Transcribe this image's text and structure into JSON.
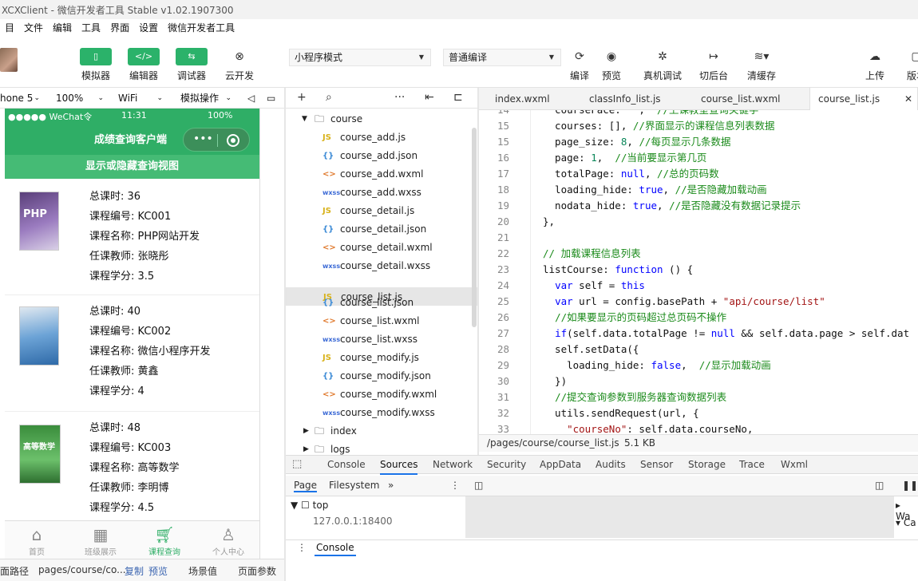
{
  "titlebar": {
    "title": "XCXClient - 微信开发者工具 Stable v1.02.1907300"
  },
  "menu": [
    "目",
    "文件",
    "编辑",
    "工具",
    "界面",
    "设置",
    "微信开发者工具"
  ],
  "toolbar": {
    "simulator": "模拟器",
    "editor": "编辑器",
    "debugger": "调试器",
    "cloud": "云开发",
    "mode_select": "小程序模式",
    "compile_select": "普通编译",
    "compile": "编译",
    "preview": "预览",
    "remote_debug": "真机调试",
    "background": "切后台",
    "clear_cache": "清缓存",
    "upload": "上传",
    "version": "版本"
  },
  "simstrip": {
    "device": "hone 5",
    "zoom": "100%",
    "network": "WiFi",
    "operate": "模拟操作"
  },
  "phone": {
    "status_left": "●●●●● WeChat令",
    "status_time": "11:31",
    "status_right": "100%",
    "nav_title": "成绩查询客户端",
    "toggle": "显示或隐藏查询视图",
    "courses": [
      {
        "hours": "总课时: 36",
        "no": "课程编号: KC001",
        "name": "课程名称: PHP网站开发",
        "teacher": "任课教师: 张晓彤",
        "credit": "课程学分: 3.5",
        "cover": "PHP"
      },
      {
        "hours": "总课时: 40",
        "no": "课程编号: KC002",
        "name": "课程名称: 微信小程序开发",
        "teacher": "任课教师: 黄鑫",
        "credit": "课程学分: 4",
        "cover": ""
      },
      {
        "hours": "总课时: 48",
        "no": "课程编号: KC003",
        "name": "课程名称: 高等数学",
        "teacher": "任课教师: 李明博",
        "credit": "课程学分: 4.5",
        "cover": "高等数学"
      }
    ],
    "tabs": [
      "首页",
      "班级展示",
      "课程查询",
      "个人中心"
    ]
  },
  "leftstatus": {
    "path_label": "面路径",
    "path": "pages/course/co...",
    "copy": "复制",
    "preview": "预览",
    "scene": "场景值",
    "params": "页面参数"
  },
  "tree": {
    "folder": "course",
    "files": [
      {
        "icon": "JS",
        "name": "course_add.js",
        "color": "#d8b21a"
      },
      {
        "icon": "{}",
        "name": "course_add.json",
        "color": "#3d8bd6"
      },
      {
        "icon": "<>",
        "name": "course_add.wxml",
        "color": "#e07a2e"
      },
      {
        "icon": "wxss",
        "name": "course_add.wxss",
        "color": "#3d6bd6"
      },
      {
        "icon": "JS",
        "name": "course_detail.js",
        "color": "#d8b21a"
      },
      {
        "icon": "{}",
        "name": "course_detail.json",
        "color": "#3d8bd6"
      },
      {
        "icon": "<>",
        "name": "course_detail.wxml",
        "color": "#e07a2e"
      },
      {
        "icon": "wxss",
        "name": "course_detail.wxss",
        "color": "#3d6bd6"
      },
      {
        "icon": "JS",
        "name": "course_list.js",
        "color": "#d8b21a"
      },
      {
        "icon": "{}",
        "name": "course_list.json",
        "color": "#3d8bd6"
      },
      {
        "icon": "<>",
        "name": "course_list.wxml",
        "color": "#e07a2e"
      },
      {
        "icon": "wxss",
        "name": "course_list.wxss",
        "color": "#3d6bd6"
      },
      {
        "icon": "JS",
        "name": "course_modify.js",
        "color": "#d8b21a"
      },
      {
        "icon": "{}",
        "name": "course_modify.json",
        "color": "#3d8bd6"
      },
      {
        "icon": "<>",
        "name": "course_modify.wxml",
        "color": "#e07a2e"
      },
      {
        "icon": "wxss",
        "name": "course_modify.wxss",
        "color": "#3d6bd6"
      }
    ],
    "folders_after": [
      "index",
      "logs"
    ]
  },
  "editor": {
    "tabs": [
      "index.wxml",
      "classInfo_list.js",
      "course_list.wxml",
      "course_list.js"
    ],
    "status_path": "/pages/course/course_list.js",
    "status_size": "5.1 KB"
  },
  "devtools": {
    "tabs": [
      "Console",
      "Sources",
      "Network",
      "Security",
      "AppData",
      "Audits",
      "Sensor",
      "Storage",
      "Trace",
      "Wxml"
    ],
    "subtabs": [
      "Page",
      "Filesystem"
    ],
    "tree_top": "top",
    "tree_host": "127.0.0.1:18400",
    "side": [
      "Wa",
      "Ca"
    ],
    "console": "Console"
  }
}
